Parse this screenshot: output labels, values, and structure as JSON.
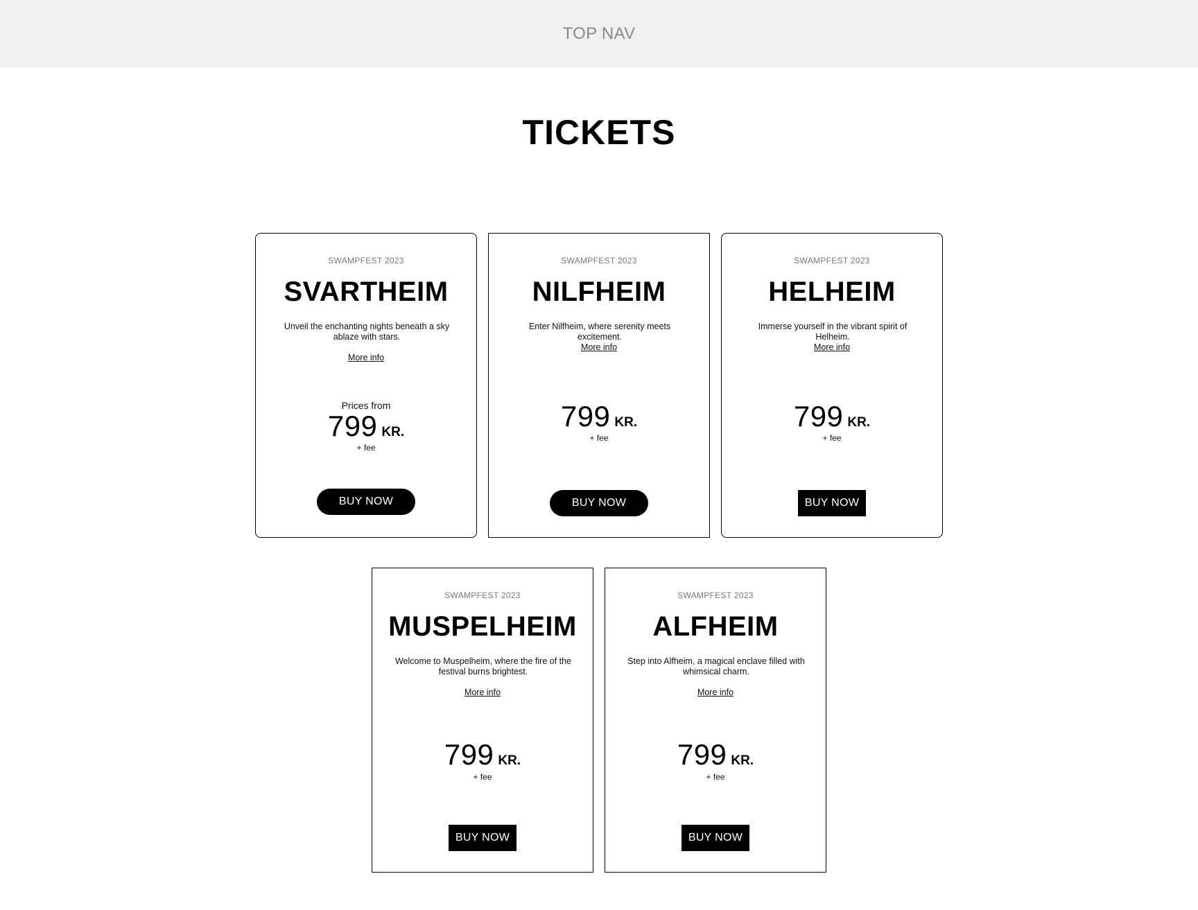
{
  "topnav": {
    "label": "TOP NAV"
  },
  "page": {
    "title": "TICKETS"
  },
  "cards": [
    {
      "event": "SWAMPFEST 2023",
      "name": "SVARTHEIM",
      "description": "Unveil the enchanting nights beneath a sky ablaze with stars.",
      "more_info": "More info",
      "prices_from": "Prices from",
      "price": "799",
      "currency": "KR.",
      "fee": "+ fee",
      "button": "BUY NOW"
    },
    {
      "event": "SWAMPFEST 2023",
      "name": "NILFHEIM",
      "description": "Enter Nilfheim, where serenity meets excitement.",
      "more_info": "More info",
      "price": "799",
      "currency": "KR.",
      "fee": "+ fee",
      "button": "BUY NOW"
    },
    {
      "event": "SWAMPFEST 2023",
      "name": "HELHEIM",
      "description": "Immerse yourself in the vibrant spirit of Helheim.",
      "more_info": "More info",
      "price": "799",
      "currency": "KR.",
      "fee": "+ fee",
      "button": "BUY NOW"
    },
    {
      "event": "SWAMPFEST 2023",
      "name": "MUSPELHEIM",
      "description": "Welcome to Muspelheim, where the fire of the festival burns brightest.",
      "more_info": "More info",
      "price": "799",
      "currency": "KR.",
      "fee": "+ fee",
      "button": "BUY NOW"
    },
    {
      "event": "SWAMPFEST 2023",
      "name": "ALFHEIM",
      "description": "Step into Alfheim, a magical enclave filled with whimsical charm.",
      "more_info": "More info",
      "price": "799",
      "currency": "KR.",
      "fee": "+ fee",
      "button": "BUY NOW"
    }
  ]
}
